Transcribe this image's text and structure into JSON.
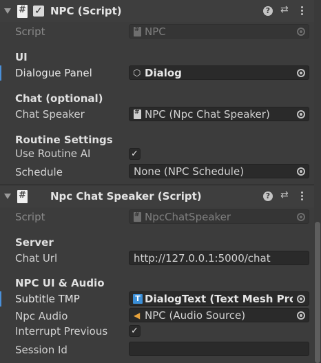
{
  "components": [
    {
      "title": "NPC (Script)",
      "enabled_mark": "✓",
      "script": {
        "label": "Script",
        "value": "NPC"
      },
      "sections": {
        "ui": "UI",
        "chat": "Chat (optional)",
        "routine": "Routine Settings"
      },
      "fields": {
        "dialogue_panel": {
          "label": "Dialogue Panel",
          "value": "Dialog"
        },
        "chat_speaker": {
          "label": "Chat Speaker",
          "value": "NPC (Npc Chat Speaker)"
        },
        "use_routine_ai": {
          "label": "Use Routine AI",
          "checked": true,
          "mark": "✓"
        },
        "schedule": {
          "label": "Schedule",
          "value": "None (NPC Schedule)"
        }
      }
    },
    {
      "title": "Npc Chat Speaker (Script)",
      "script": {
        "label": "Script",
        "value": "NpcChatSpeaker"
      },
      "sections": {
        "server": "Server",
        "ui_audio": "NPC UI & Audio"
      },
      "fields": {
        "chat_url": {
          "label": "Chat Url",
          "value": "http://127.0.0.1:5000/chat"
        },
        "subtitle_tmp": {
          "label": "Subtitle TMP",
          "value": "DialogText (Text Mesh Pro UGUI)"
        },
        "npc_audio": {
          "label": "Npc Audio",
          "value": "NPC (Audio Source)"
        },
        "interrupt_previous": {
          "label": "Interrupt Previous",
          "checked": true,
          "mark": "✓"
        },
        "session_id": {
          "label": "Session Id",
          "value": ""
        }
      }
    }
  ],
  "header_icons": {
    "help": "?",
    "presets": "⇄",
    "menu": "kebab-icon"
  },
  "colors": {
    "background": "#3c3c3c",
    "field_bg": "#2a2a2a",
    "modified_bar": "#4a90d9",
    "tmp_icon": "#3b8fd8",
    "audio_icon": "#e8a23a"
  }
}
